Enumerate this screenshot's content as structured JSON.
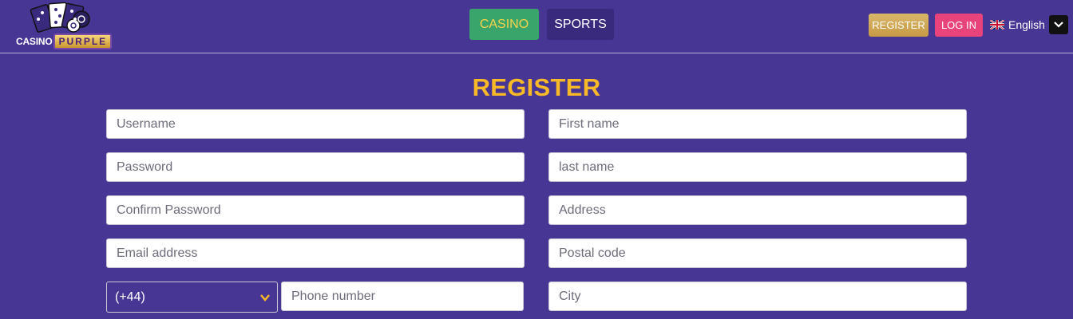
{
  "logo": {
    "casino_text": "CASINO",
    "purple_text": "PURPLE"
  },
  "nav": {
    "casino_label": "CASINO",
    "sports_label": "SPORTS"
  },
  "header": {
    "register_label": "REGISTER",
    "login_label": "LOG IN",
    "language_label": "English"
  },
  "page": {
    "title": "REGISTER"
  },
  "form": {
    "left": [
      {
        "placeholder": "Username"
      },
      {
        "placeholder": "Password"
      },
      {
        "placeholder": "Confirm Password"
      },
      {
        "placeholder": "Email address"
      }
    ],
    "right": [
      {
        "placeholder": "First name"
      },
      {
        "placeholder": "last name"
      },
      {
        "placeholder": "Address"
      },
      {
        "placeholder": "Postal code"
      },
      {
        "placeholder": "City"
      }
    ],
    "phone_code": "(+44)",
    "phone_placeholder": "Phone number"
  },
  "colors": {
    "background": "#473693",
    "accent_gold": "#f7b928",
    "casino_green": "#3aa56b",
    "login_pink": "#e8437a"
  },
  "icons": {
    "logo": "casino-cards-icon",
    "flag": "uk-flag-icon",
    "lang_toggle": "chevron-down-icon",
    "select_arrow": "chevron-down-icon"
  }
}
